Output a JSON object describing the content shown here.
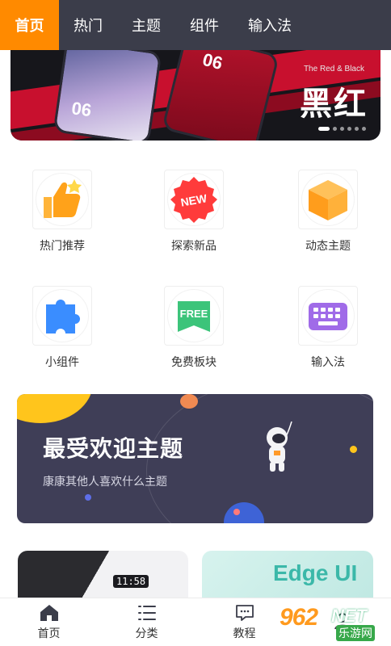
{
  "top_tabs": [
    {
      "label": "首页",
      "active": true
    },
    {
      "label": "热门",
      "active": false
    },
    {
      "label": "主题",
      "active": false
    },
    {
      "label": "组件",
      "active": false
    },
    {
      "label": "输入法",
      "active": false
    }
  ],
  "banner": {
    "subtitle_en": "The Red & Black",
    "title_cn": "黑红",
    "phone_time_1": "06",
    "phone_time_2": "06",
    "slide_count": 6,
    "active_slide": 1
  },
  "grid_items": [
    {
      "label": "热门推荐",
      "icon": "thumbs-up-icon"
    },
    {
      "label": "探索新品",
      "icon": "new-badge-icon",
      "badge": "NEW"
    },
    {
      "label": "动态主题",
      "icon": "cube-icon"
    },
    {
      "label": "小组件",
      "icon": "puzzle-icon"
    },
    {
      "label": "免费板块",
      "icon": "free-ribbon-icon",
      "badge": "FREE"
    },
    {
      "label": "输入法",
      "icon": "keyboard-icon"
    }
  ],
  "promo": {
    "title": "最受欢迎主题",
    "subtitle": "康康其他人喜欢什么主题"
  },
  "previews": {
    "left_time": "11:58",
    "right_text": "Edge UI"
  },
  "bottom_nav": [
    {
      "label": "首页",
      "icon": "home-icon",
      "active": true
    },
    {
      "label": "分类",
      "icon": "list-icon",
      "active": false
    },
    {
      "label": "教程",
      "icon": "chat-tutorial-icon",
      "active": false
    },
    {
      "label": "",
      "icon": "profile-icon",
      "active": false
    }
  ],
  "watermark": {
    "number": "962",
    "net": "NET",
    "cn": "乐游网"
  },
  "colors": {
    "topbar_bg": "#3b3d4a",
    "active_tab": "#ff8a00",
    "promo_bg": "#3f3e57"
  }
}
